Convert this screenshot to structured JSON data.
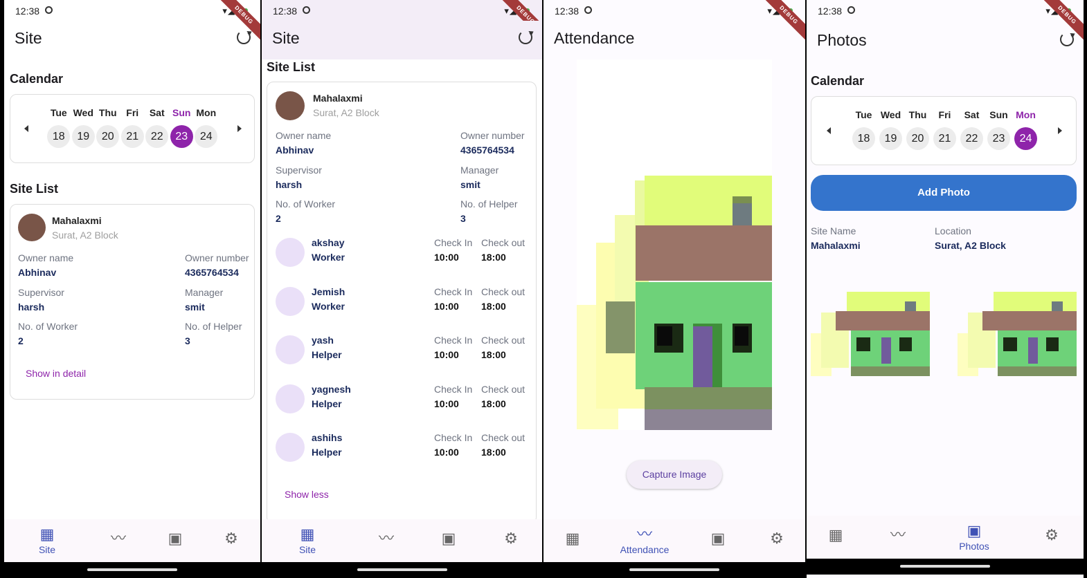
{
  "status": {
    "time": "12:38",
    "signal_text": "▾◢▮",
    "debug": "DEBUG"
  },
  "screens": {
    "site_collapsed": {
      "title": "Site",
      "calendar_title": "Calendar",
      "calendar": {
        "days": [
          {
            "name": "Tue",
            "num": "18"
          },
          {
            "name": "Wed",
            "num": "19"
          },
          {
            "name": "Thu",
            "num": "20"
          },
          {
            "name": "Fri",
            "num": "21"
          },
          {
            "name": "Sat",
            "num": "22"
          },
          {
            "name": "Sun",
            "num": "23"
          },
          {
            "name": "Mon",
            "num": "24"
          }
        ],
        "selected": "23"
      },
      "site_list_title": "Site List",
      "site": {
        "name": "Mahalaxmi",
        "location": "Surat, A2 Block",
        "owner_name_label": "Owner name",
        "owner_name": "Abhinav",
        "owner_number_label": "Owner number",
        "owner_number": "4365764534",
        "supervisor_label": "Supervisor",
        "supervisor": "harsh",
        "manager_label": "Manager",
        "manager": "smit",
        "workers_label": "No. of Worker",
        "workers": "2",
        "helpers_label": "No. of Helper",
        "helpers": "3"
      },
      "show_link": "Show in detail"
    },
    "site_expanded": {
      "title": "Site",
      "site_list_title": "Site List",
      "site": {
        "name": "Mahalaxmi",
        "location": "Surat, A2 Block",
        "owner_name_label": "Owner name",
        "owner_name": "Abhinav",
        "owner_number_label": "Owner number",
        "owner_number": "4365764534",
        "supervisor_label": "Supervisor",
        "supervisor": "harsh",
        "manager_label": "Manager",
        "manager": "smit",
        "workers_label": "No. of Worker",
        "workers": "2",
        "helpers_label": "No. of Helper",
        "helpers": "3"
      },
      "check_in_label": "Check In",
      "check_out_label": "Check out",
      "workers": [
        {
          "name": "akshay",
          "role": "Worker",
          "in": "10:00",
          "out": "18:00"
        },
        {
          "name": "Jemish",
          "role": "Worker",
          "in": "10:00",
          "out": "18:00"
        },
        {
          "name": "yash",
          "role": "Helper",
          "in": "10:00",
          "out": "18:00"
        },
        {
          "name": "yagnesh",
          "role": "Helper",
          "in": "10:00",
          "out": "18:00"
        },
        {
          "name": "ashihs",
          "role": "Helper",
          "in": "10:00",
          "out": "18:00"
        }
      ],
      "show_link": "Show less"
    },
    "attendance": {
      "title": "Attendance",
      "capture_button": "Capture Image"
    },
    "photos": {
      "title": "Photos",
      "calendar_title": "Calendar",
      "calendar": {
        "days": [
          {
            "name": "Tue",
            "num": "18"
          },
          {
            "name": "Wed",
            "num": "19"
          },
          {
            "name": "Thu",
            "num": "20"
          },
          {
            "name": "Fri",
            "num": "21"
          },
          {
            "name": "Sat",
            "num": "22"
          },
          {
            "name": "Sun",
            "num": "23"
          },
          {
            "name": "Mon",
            "num": "24"
          }
        ],
        "selected": "24"
      },
      "add_photo": "Add Photo",
      "site_name_label": "Site Name",
      "site_name": "Mahalaxmi",
      "location_label": "Location",
      "location": "Surat, A2 Block"
    }
  },
  "nav": {
    "site": "Site",
    "attendance": "Attendance",
    "photos": "Photos"
  },
  "colors": {
    "accent": "#8e24aa",
    "nav_active": "#3f51b5",
    "add_photo": "#3474cc",
    "avatar": "#795548"
  }
}
